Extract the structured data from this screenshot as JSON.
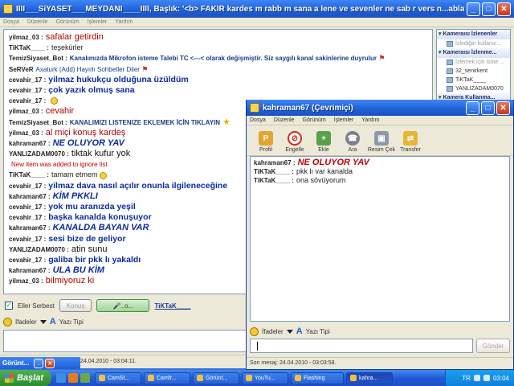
{
  "main_window": {
    "title": "IIII___SiYASET___MEYDANI____IIII, Başlık: '<b> FAKİR kardes  m rabb  m sana a  lene ve sevenler  ne sab  r vers  n...ablam  za rahmet d  l  yoruz ...",
    "menu": [
      "Dosya",
      "Düzenle",
      "Görünüm",
      "İşlemler",
      "Yardım"
    ],
    "messages": [
      {
        "user": "yilmaz_03 :",
        "text": "safalar getirdin",
        "style": "red"
      },
      {
        "user": "TiKTaK____ :",
        "text": "teşekürler",
        "style": "black"
      },
      {
        "user": "TemizSiyaset_Bot :",
        "text": "Kanalımızda Mikrofon isteme Talebi  TC <---<  olarak değişmiştir. Siz saygılı kanal sakinlerine  duyrulur",
        "style": "bot",
        "suffix": "flag"
      },
      {
        "user": "SeRVeR",
        "text": "Axaturk (Add)   Hayırlı Sohbetler Diler",
        "style": "server",
        "suffix": "flag"
      },
      {
        "user": "cevahir_17 :",
        "text": "yilmaz hukukçu olduğuna üzüldüm",
        "style": "blue"
      },
      {
        "user": "cevahir_17 :",
        "text": "çok yazık olmuş sana",
        "style": "blue"
      },
      {
        "user": "cevahir_17 :",
        "text": "",
        "style": "blue",
        "suffix": "smile"
      },
      {
        "user": "yilmaz_03 :",
        "text": "cevahir",
        "style": "red"
      },
      {
        "user": "TemizSiyaset_Bot :",
        "text": "KANALIMIZI LISTENIZE EKLEMEK İCİN TIKLAYIN",
        "style": "bot",
        "suffix": "star"
      },
      {
        "user": "yilmaz_03 :",
        "text": "al miçi konuş kardeş",
        "style": "red"
      },
      {
        "user": "kahraman67 :",
        "text": "NE OLUYOR YAV",
        "style": "bluei"
      },
      {
        "user": "YANLIZADAM0070 :",
        "text": "tiktak  kufur  yok",
        "style": "black_big"
      },
      {
        "user": "",
        "text": "New item was added to ignore list",
        "style": "sys"
      },
      {
        "user": "TiKTaK____ :",
        "text": "tamam etmem",
        "style": "black",
        "suffix": "smile"
      },
      {
        "user": "cevahir_17 :",
        "text": "yilmaz dava nasıl açılır onunla ilgileneceğine",
        "style": "blue"
      },
      {
        "user": "kahraman67 :",
        "text": "KİM PKKLI",
        "style": "bluei"
      },
      {
        "user": "cevahir_17 :",
        "text": "yok mu aranızda yeşil",
        "style": "blue"
      },
      {
        "user": "cevahir_17 :",
        "text": "başka kanalda konuşuyor",
        "style": "blue"
      },
      {
        "user": "kahraman67 :",
        "text": "KANALDA BAYAN VAR",
        "style": "bluei"
      },
      {
        "user": "cevahir_17 :",
        "text": "sesi bize de geliyor",
        "style": "blue"
      },
      {
        "user": "YANLIZADAM0070 :",
        "text": "atin  sunu",
        "style": "black_big"
      },
      {
        "user": "cevahir_17 :",
        "text": "galiba bir pkk lı yakaldı",
        "style": "blue"
      },
      {
        "user": "kahraman67 :",
        "text": "ULA BU KİM",
        "style": "bluei"
      },
      {
        "user": "yilmaz_03 :",
        "text": "bilmiyoruz ki",
        "style": "red"
      }
    ],
    "right_panel": {
      "section1": "Kameraısı İzlenenler",
      "section1_items": [
        {
          "label": "İzlediğin kullanıc...",
          "gray": true
        }
      ],
      "section2": "Kameraısı İzlenme...",
      "section2_items": [
        {
          "label": "İzlemek için isme ...",
          "gray": true
        },
        {
          "label": "32_senirkent",
          "gray": false
        },
        {
          "label": "TiKTaK____",
          "gray": false
        },
        {
          "label": "YANLIZADAM0070",
          "gray": false
        }
      ],
      "section3": "Kamera Kullanma..."
    },
    "bottom": {
      "eller_serbest": "Eller Serbest",
      "konus": "Konuş",
      "mic_label": "..o...",
      "nick_link": "TiKTaK____"
    },
    "format": {
      "ifadeler": "İfadeler",
      "yazi_tipi": "Yazı Tipi"
    },
    "status": "24.04.2010 - 03:04:11."
  },
  "mini_window": {
    "title": "Görünt..."
  },
  "pm_window": {
    "title": "kahraman67 (Çevrimiçi)",
    "menu": [
      "Dosya",
      "Düzenle",
      "Görünüm",
      "İşlemler",
      "Yardım"
    ],
    "toolbar": [
      {
        "label": "Profil",
        "icon": "profile-icon",
        "key": "profil"
      },
      {
        "label": "Engelle",
        "icon": "block-icon",
        "key": "engelle"
      },
      {
        "label": "Ekle",
        "icon": "add-icon",
        "key": "ekle"
      },
      {
        "label": "Ara",
        "icon": "call-icon",
        "key": "ara"
      },
      {
        "label": "Resim Çek",
        "icon": "camera-icon",
        "key": "resim"
      },
      {
        "label": "Transfer",
        "icon": "transfer-icon",
        "key": "transfer"
      }
    ],
    "messages": [
      {
        "user": "kahraman67 :",
        "text": "NE OLUYOR YAV",
        "style": "redi"
      },
      {
        "user": "TiKTaK____ :",
        "text": "pkk lı var kanalda",
        "style": "black"
      },
      {
        "user": "TiKTaK____ :",
        "text": "ona sövüyorum",
        "style": "black"
      }
    ],
    "format": {
      "ifadeler": "İfadeler",
      "yazi_tipi": "Yazı Tipi"
    },
    "send": "Gönder",
    "status": "Son mesaj: 24.04.2010 - 03:03:58."
  },
  "taskbar": {
    "start": "Başlat",
    "tasks": [
      {
        "label": "CamSt...",
        "active": false
      },
      {
        "label": "Camfr...",
        "active": false
      },
      {
        "label": "Görünt...",
        "active": false
      },
      {
        "label": "YouTu...",
        "active": false
      },
      {
        "label": "Flashing",
        "active": false
      },
      {
        "label": "kahra...",
        "active": true
      }
    ],
    "lang": "TR",
    "clock": "03:04"
  }
}
